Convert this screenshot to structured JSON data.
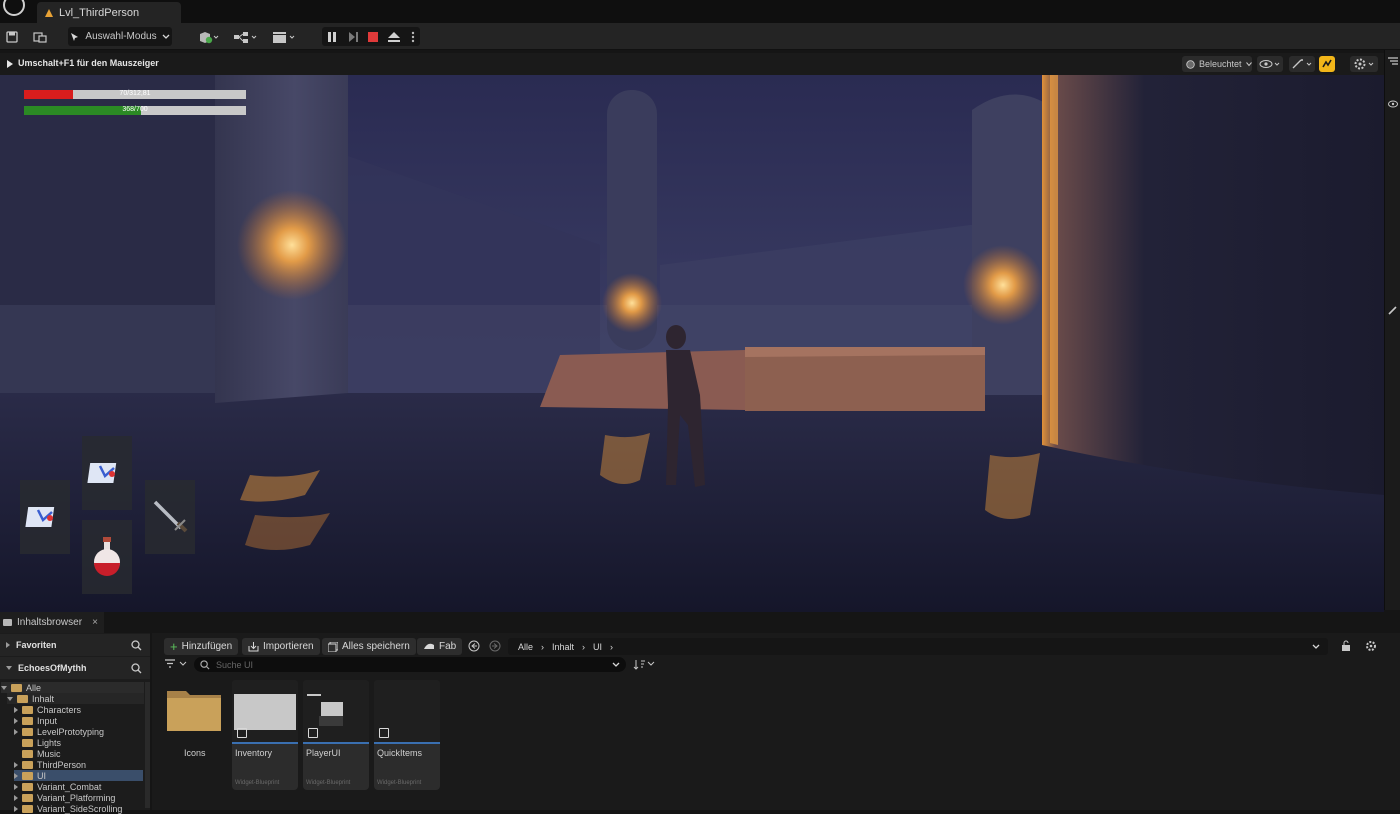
{
  "window": {
    "level_tab": "Lvl_ThirdPerson"
  },
  "toolbar": {
    "mode_label": "Auswahl-Modus"
  },
  "viewport": {
    "hint": "Umschalt+F1 für den Mauszeiger",
    "view_mode": "Beleuchtet",
    "hud": {
      "health_text": "70/312,81",
      "health_fraction": 0.22,
      "stamina_text": "368/700",
      "stamina_fraction": 0.526
    }
  },
  "content_browser": {
    "tab_label": "Inhaltsbrowser",
    "favorites_label": "Favoriten",
    "project_label": "EchoesOfMythh",
    "tree": [
      {
        "label": "Alle"
      },
      {
        "label": "Inhalt"
      },
      {
        "label": "Characters"
      },
      {
        "label": "Input"
      },
      {
        "label": "LevelPrototyping"
      },
      {
        "label": "Lights"
      },
      {
        "label": "Music"
      },
      {
        "label": "ThirdPerson"
      },
      {
        "label": "UI"
      },
      {
        "label": "Variant_Combat"
      },
      {
        "label": "Variant_Platforming"
      },
      {
        "label": "Variant_SideScrolling"
      }
    ],
    "buttons": {
      "add": "Hinzufügen",
      "import": "Importieren",
      "save_all": "Alles speichern",
      "fab": "Fab"
    },
    "breadcrumb": [
      "Alle",
      "Inhalt",
      "UI"
    ],
    "search_placeholder": "Suche UI",
    "assets": [
      {
        "name": "Icons",
        "type": ""
      },
      {
        "name": "Inventory",
        "type": "Widget-Blueprint"
      },
      {
        "name": "PlayerUI",
        "type": "Widget-Blueprint"
      },
      {
        "name": "QuickItems",
        "type": "Widget-Blueprint"
      }
    ]
  },
  "colors": {
    "accent_blue": "#3a6fb0",
    "health_red": "#d81d1d",
    "stamina_green": "#2b8a24",
    "folder_tan": "#c9a15a",
    "stop_red": "#e03a3a",
    "warning_yellow": "#f2b619"
  }
}
